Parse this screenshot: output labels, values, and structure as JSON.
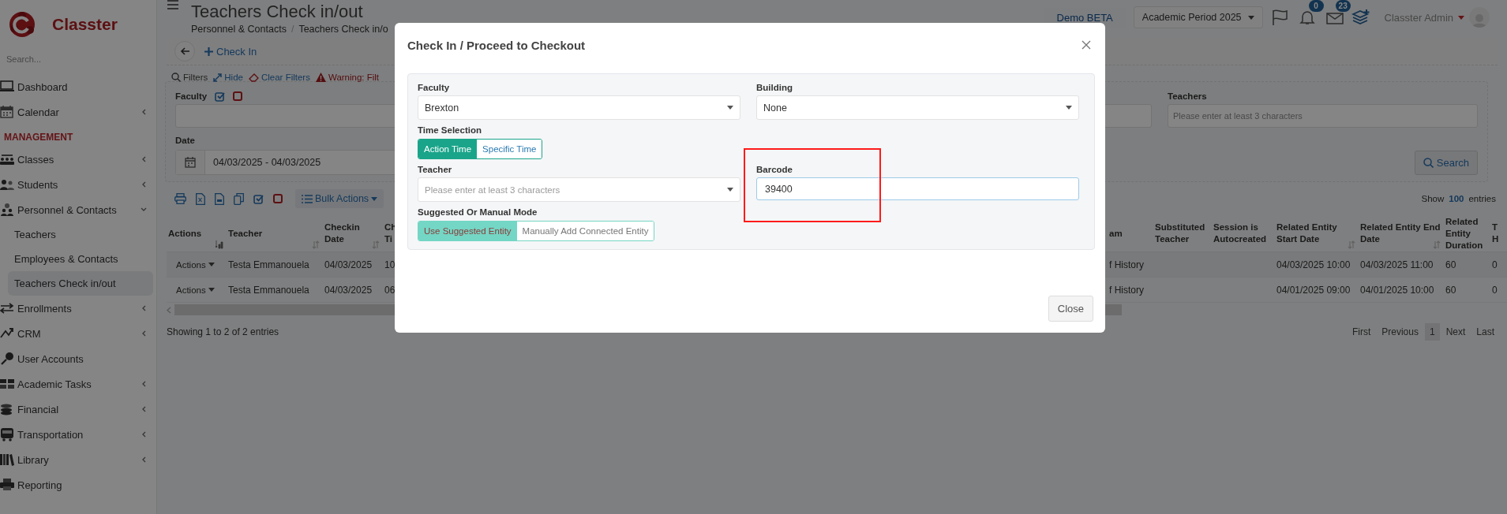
{
  "sidebar": {
    "brand": "Classter",
    "search": {
      "placeholder": "Search..."
    },
    "sections": [
      {
        "items": [
          {
            "label": "Dashboard",
            "expandable": false,
            "selected": false
          },
          {
            "label": "Calendar",
            "expandable": true,
            "expanded": false,
            "selected": false
          }
        ]
      },
      {
        "heading": "MANAGEMENT",
        "items": [
          {
            "label": "Classes",
            "expandable": true,
            "expanded": false,
            "selected": false
          },
          {
            "label": "Students",
            "expandable": true,
            "expanded": false,
            "selected": false
          },
          {
            "label": "Personnel & Contacts",
            "expandable": true,
            "expanded": true,
            "selected": false,
            "children": [
              {
                "label": "Teachers",
                "selected": false
              },
              {
                "label": "Employees & Contacts",
                "selected": false
              },
              {
                "label": "Teachers Check in/out",
                "selected": true
              }
            ]
          },
          {
            "label": "Enrollments",
            "expandable": true,
            "expanded": false,
            "selected": false
          },
          {
            "label": "CRM",
            "expandable": true,
            "expanded": false,
            "selected": false
          },
          {
            "label": "User Accounts",
            "expandable": false,
            "selected": false
          },
          {
            "label": "Academic Tasks",
            "expandable": true,
            "expanded": false,
            "selected": false
          },
          {
            "label": "Financial",
            "expandable": true,
            "expanded": false,
            "selected": false
          },
          {
            "label": "Transportation",
            "expandable": true,
            "expanded": false,
            "selected": false
          },
          {
            "label": "Library",
            "expandable": true,
            "expanded": false,
            "selected": false
          },
          {
            "label": "Reporting",
            "expandable": false,
            "selected": false
          }
        ]
      }
    ]
  },
  "header": {
    "title": "Teachers Check in/out",
    "breadcrumb": [
      "Personnel & Contacts",
      "Teachers Check in/o"
    ],
    "breadcrumb_separator": "/",
    "demo_button": "Demo BETA",
    "period_select": "Academic Period 2025",
    "notifications_count": "0",
    "messages_count": "23",
    "user_name": "Classter Admin"
  },
  "action_bar": {
    "check_in": "Check In"
  },
  "filters": {
    "toggle": "Filters",
    "hide": "Hide",
    "clear": "Clear Filters",
    "warning": "Warning: Filt",
    "faculty_label": "Faculty",
    "date_label": "Date",
    "date_value": "04/03/2025 - 04/03/2025",
    "teachers_label": "Teachers",
    "teachers_placeholder": "Please enter at least 3 characters",
    "search_button": "Search"
  },
  "table": {
    "bulk_actions": "Bulk Actions",
    "show_label": "Show",
    "page_size": "100",
    "entries_label": "entries",
    "columns": [
      {
        "label": "Actions",
        "sortable": true,
        "sorted": true
      },
      {
        "label": "Teacher",
        "sortable": true,
        "sorted": false
      },
      {
        "label": "Checkin Date",
        "sortable": true,
        "sorted": false
      },
      {
        "label": "Ch Ti",
        "sortable": false
      },
      {
        "label": "am",
        "sortable": false
      },
      {
        "label": "Substituted Teacher",
        "sortable": false
      },
      {
        "label": "Session is Autocreated",
        "sortable": false
      },
      {
        "label": "Related Entity Start Date",
        "sortable": true,
        "sorted": false
      },
      {
        "label": "Related Entity End Date",
        "sortable": true,
        "sorted": false
      },
      {
        "label": "Related Entity Duration",
        "sortable": false
      },
      {
        "label": "T H",
        "sortable": false
      }
    ],
    "rows": [
      {
        "cells": [
          "Actions",
          "Testa Emmanouela",
          "04/03/2025",
          "10",
          "f History",
          null,
          null,
          "04/03/2025 10:00",
          "04/03/2025 11:00",
          "60",
          "0"
        ]
      },
      {
        "cells": [
          "Actions",
          "Testa Emmanouela",
          "04/03/2025",
          "06",
          "f History",
          null,
          null,
          "04/01/2025 09:00",
          "04/01/2025 10:00",
          "60",
          "0"
        ]
      }
    ],
    "info": "Showing 1 to 2 of 2 entries",
    "pagination": [
      {
        "label": "First",
        "selected": false
      },
      {
        "label": "Previous",
        "selected": false
      },
      {
        "label": "1",
        "selected": true
      },
      {
        "label": "Next",
        "selected": false
      },
      {
        "label": "Last",
        "selected": false
      }
    ]
  },
  "modal": {
    "title": "Check In / Proceed to Checkout",
    "faculty": {
      "label": "Faculty",
      "value": "Brexton"
    },
    "building": {
      "label": "Building",
      "value": "None"
    },
    "time_selection": {
      "label": "Time Selection",
      "disabled": false,
      "options": [
        {
          "label": "Action Time",
          "selected": true
        },
        {
          "label": "Specific Time",
          "selected": false
        }
      ]
    },
    "teacher": {
      "label": "Teacher",
      "placeholder": "Please enter at least 3 characters"
    },
    "barcode": {
      "label": "Barcode",
      "value": "39400",
      "focused": true
    },
    "mode": {
      "label": "Suggested Or Manual Mode",
      "disabled": true,
      "options": [
        {
          "label": "Use Suggested Entity",
          "selected": true
        },
        {
          "label": "Manually Add Connected Entity",
          "selected": false
        }
      ]
    },
    "close_button": "Close"
  }
}
